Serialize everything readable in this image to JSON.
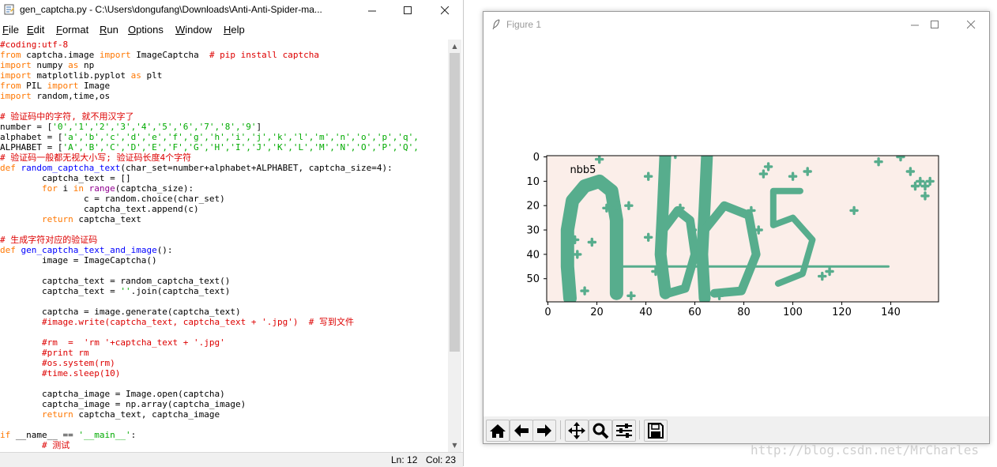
{
  "editor": {
    "title": "gen_captcha.py - C:\\Users\\dongufang\\Downloads\\Anti-Anti-Spider-ma...",
    "menu": [
      "File",
      "Edit",
      "Format",
      "Run",
      "Options",
      "Window",
      "Help"
    ],
    "status_line": "Ln: 12",
    "status_col": "Col: 23",
    "code_lines": [
      [
        [
          "cm",
          "#coding:utf-8"
        ]
      ],
      [
        [
          "kw",
          "from"
        ],
        [
          "",
          " captcha.image "
        ],
        [
          "kw",
          "import"
        ],
        [
          "",
          " ImageCaptcha  "
        ],
        [
          "cm",
          "# pip install captcha"
        ]
      ],
      [
        [
          "kw",
          "import"
        ],
        [
          "",
          " numpy "
        ],
        [
          "kw",
          "as"
        ],
        [
          "",
          " np"
        ]
      ],
      [
        [
          "kw",
          "import"
        ],
        [
          "",
          " matplotlib.pyplot "
        ],
        [
          "kw",
          "as"
        ],
        [
          "",
          " plt"
        ]
      ],
      [
        [
          "kw",
          "from"
        ],
        [
          "",
          " PIL "
        ],
        [
          "kw",
          "import"
        ],
        [
          "",
          " Image"
        ]
      ],
      [
        [
          "kw",
          "import"
        ],
        [
          "",
          " random,time,os"
        ]
      ],
      [
        [
          "",
          ""
        ]
      ],
      [
        [
          "cm",
          "# 验证码中的字符, 就不用汉字了"
        ]
      ],
      [
        [
          "",
          "number = ["
        ],
        [
          "st",
          "'0','1','2','3','4','5','6','7','8','9'"
        ],
        [
          "",
          "]"
        ]
      ],
      [
        [
          "",
          "alphabet = ["
        ],
        [
          "st",
          "'a','b','c','d','e','f','g','h','i','j','k','l','m','n','o','p','q',"
        ]
      ],
      [
        [
          "",
          "ALPHABET = ["
        ],
        [
          "st",
          "'A','B','C','D','E','F','G','H','I','J','K','L','M','N','O','P','Q',"
        ]
      ],
      [
        [
          "cm",
          "# 验证码一般都无视大小写; 验证码长度4个字符"
        ]
      ],
      [
        [
          "kw",
          "def"
        ],
        [
          "",
          " "
        ],
        [
          "df",
          "random_captcha_text"
        ],
        [
          "",
          "(char_set=number+alphabet+ALPHABET, captcha_size=4):"
        ]
      ],
      [
        [
          "",
          "        captcha_text = []"
        ]
      ],
      [
        [
          "",
          "        "
        ],
        [
          "kw",
          "for"
        ],
        [
          "",
          " i "
        ],
        [
          "kw",
          "in"
        ],
        [
          "",
          " "
        ],
        [
          "bi",
          "range"
        ],
        [
          "",
          "(captcha_size):"
        ]
      ],
      [
        [
          "",
          "                c = random.choice(char_set)"
        ]
      ],
      [
        [
          "",
          "                captcha_text.append(c)"
        ]
      ],
      [
        [
          "",
          "        "
        ],
        [
          "kw",
          "return"
        ],
        [
          "",
          " captcha_text"
        ]
      ],
      [
        [
          "",
          ""
        ]
      ],
      [
        [
          "cm",
          "# 生成字符对应的验证码"
        ]
      ],
      [
        [
          "kw",
          "def"
        ],
        [
          "",
          " "
        ],
        [
          "df",
          "gen_captcha_text_and_image"
        ],
        [
          "",
          "():"
        ]
      ],
      [
        [
          "",
          "        image = ImageCaptcha()"
        ]
      ],
      [
        [
          "",
          ""
        ]
      ],
      [
        [
          "",
          "        captcha_text = random_captcha_text()"
        ]
      ],
      [
        [
          "",
          "        captcha_text = "
        ],
        [
          "st",
          "''"
        ],
        [
          "",
          ".join(captcha_text)"
        ]
      ],
      [
        [
          "",
          ""
        ]
      ],
      [
        [
          "",
          "        captcha = image.generate(captcha_text)"
        ]
      ],
      [
        [
          "",
          "        "
        ],
        [
          "cm",
          "#image.write(captcha_text, captcha_text + '.jpg')  # 写到文件"
        ]
      ],
      [
        [
          "",
          ""
        ]
      ],
      [
        [
          "",
          "        "
        ],
        [
          "cm",
          "#rm  =  'rm '+captcha_text + '.jpg'"
        ]
      ],
      [
        [
          "",
          "        "
        ],
        [
          "cm",
          "#print rm"
        ]
      ],
      [
        [
          "",
          "        "
        ],
        [
          "cm",
          "#os.system(rm)"
        ]
      ],
      [
        [
          "",
          "        "
        ],
        [
          "cm",
          "#time.sleep(10)"
        ]
      ],
      [
        [
          "",
          ""
        ]
      ],
      [
        [
          "",
          "        captcha_image = Image.open(captcha)"
        ]
      ],
      [
        [
          "",
          "        captcha_image = np.array(captcha_image)"
        ]
      ],
      [
        [
          "",
          "        "
        ],
        [
          "kw",
          "return"
        ],
        [
          "",
          " captcha_text, captcha_image"
        ]
      ],
      [
        [
          "",
          ""
        ]
      ],
      [
        [
          "kw",
          "if"
        ],
        [
          "",
          " __name__ == "
        ],
        [
          "st",
          "'__main__'"
        ],
        [
          "",
          ":"
        ]
      ],
      [
        [
          "",
          "        "
        ],
        [
          "cm",
          "# 测试"
        ]
      ]
    ]
  },
  "figure": {
    "title": "Figure 1",
    "toolbar": [
      "home-icon",
      "back-icon",
      "forward-icon",
      "pan-icon",
      "zoom-icon",
      "configure-icon",
      "save-icon"
    ]
  },
  "chart_data": {
    "type": "image",
    "title": "",
    "annotation": "nbb5",
    "image_width": 160,
    "image_height": 60,
    "xticks": [
      0,
      20,
      40,
      60,
      80,
      100,
      120,
      140
    ],
    "yticks": [
      0,
      10,
      20,
      30,
      40,
      50
    ],
    "background_color": "#fbeee9",
    "glyph_color": "#4aa886"
  },
  "watermark": "http://blog.csdn.net/MrCharles"
}
